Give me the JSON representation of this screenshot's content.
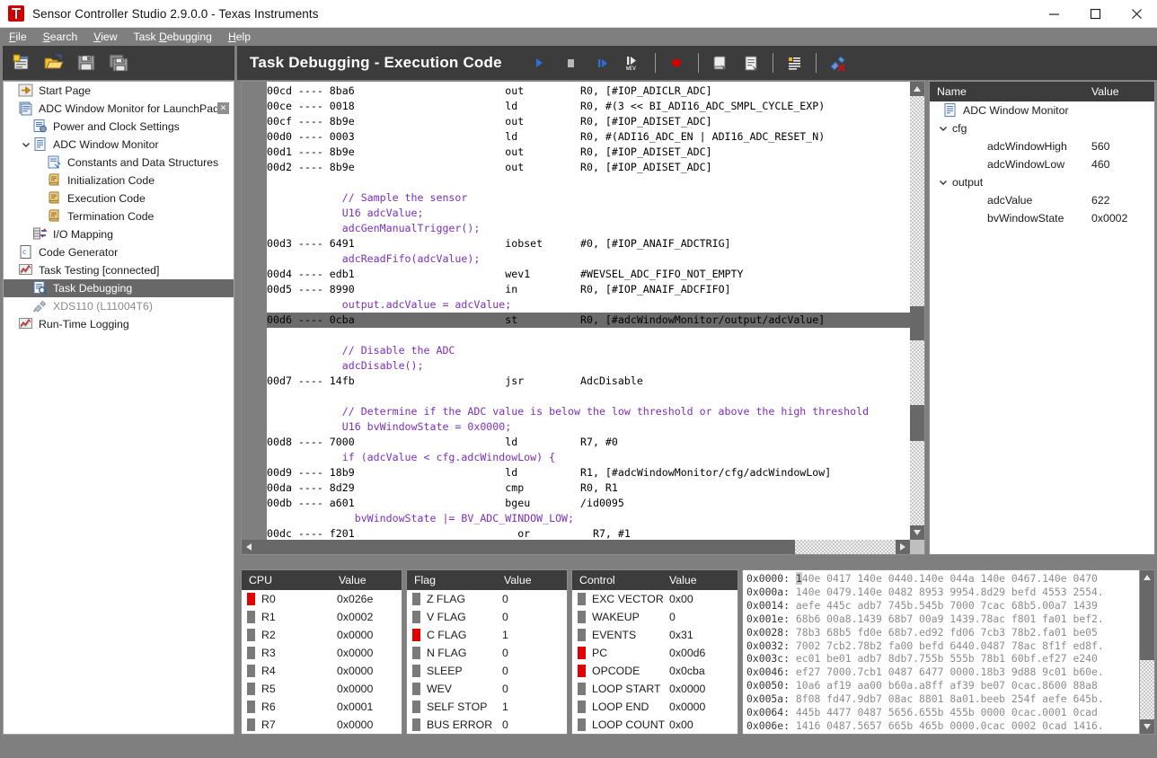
{
  "window": {
    "title": "Sensor Controller Studio 2.9.0.0 - Texas Instruments",
    "logo": "ti-logo",
    "minimize": "minimize-icon",
    "maximize": "maximize-icon",
    "close": "close-icon"
  },
  "menu": [
    {
      "label": "File",
      "mnemonic": "F"
    },
    {
      "label": "Search",
      "mnemonic": "S"
    },
    {
      "label": "View",
      "mnemonic": "V"
    },
    {
      "label": "Task Debugging",
      "mnemonic": "D"
    },
    {
      "label": "Help",
      "mnemonic": "H"
    }
  ],
  "file_toolbar": [
    {
      "name": "new-project-icon"
    },
    {
      "name": "open-project-icon"
    },
    {
      "name": "save-icon"
    },
    {
      "name": "save-all-icon"
    }
  ],
  "header": {
    "title": "Task Debugging - Execution Code",
    "tools": [
      {
        "name": "run-button",
        "kind": "play"
      },
      {
        "name": "stop-button",
        "kind": "stop"
      },
      {
        "name": "step-button",
        "kind": "step"
      },
      {
        "name": "run-to-wev-button",
        "kind": "wev"
      },
      {
        "name": "separator-1",
        "kind": "sep"
      },
      {
        "name": "breakpoint-button",
        "kind": "record"
      },
      {
        "name": "separator-2",
        "kind": "sep"
      },
      {
        "name": "show-source-button",
        "kind": "scroll"
      },
      {
        "name": "show-listing-button",
        "kind": "doc"
      },
      {
        "name": "separator-3",
        "kind": "sep"
      },
      {
        "name": "output-view-button",
        "kind": "list"
      },
      {
        "name": "separator-4",
        "kind": "sep"
      },
      {
        "name": "disconnect-button",
        "kind": "unplug"
      }
    ]
  },
  "sidebar": {
    "items": [
      {
        "label": "Start Page",
        "icon": "arrow-right-icon",
        "indent": 0,
        "chevron": "",
        "selected": false,
        "dim": false,
        "close": false
      },
      {
        "label": "ADC Window Monitor for LaunchPad*",
        "icon": "project-icon",
        "indent": 0,
        "chevron": "",
        "selected": false,
        "dim": false,
        "close": true
      },
      {
        "label": "Power and Clock Settings",
        "icon": "settings-doc-icon",
        "indent": 1,
        "chevron": "",
        "selected": false,
        "dim": false,
        "close": false
      },
      {
        "label": "ADC Window Monitor",
        "icon": "task-icon",
        "indent": 1,
        "chevron": "v",
        "selected": false,
        "dim": false,
        "close": false
      },
      {
        "label": "Constants and Data Structures",
        "icon": "constants-icon",
        "indent": 2,
        "chevron": "",
        "selected": false,
        "dim": false,
        "close": false
      },
      {
        "label": "Initialization Code",
        "icon": "code-scroll-icon",
        "indent": 2,
        "chevron": "",
        "selected": false,
        "dim": false,
        "close": false
      },
      {
        "label": "Execution Code",
        "icon": "code-scroll-icon",
        "indent": 2,
        "chevron": "",
        "selected": false,
        "dim": false,
        "close": false
      },
      {
        "label": "Termination Code",
        "icon": "code-scroll-icon",
        "indent": 2,
        "chevron": "",
        "selected": false,
        "dim": false,
        "close": false
      },
      {
        "label": "I/O Mapping",
        "icon": "io-mapping-icon",
        "indent": 1,
        "chevron": "",
        "selected": false,
        "dim": false,
        "close": false
      },
      {
        "label": "Code Generator",
        "icon": "code-generator-icon",
        "indent": 0,
        "chevron": "",
        "selected": false,
        "dim": false,
        "close": false
      },
      {
        "label": "Task Testing [connected]",
        "icon": "task-testing-icon",
        "indent": 0,
        "chevron": "",
        "selected": false,
        "dim": false,
        "close": false
      },
      {
        "label": "Task Debugging",
        "icon": "task-debugging-icon",
        "indent": 1,
        "chevron": "",
        "selected": true,
        "dim": false,
        "close": false
      },
      {
        "label": "XDS110 (L11004T6)",
        "icon": "probe-icon",
        "indent": 1,
        "chevron": "",
        "selected": false,
        "dim": true,
        "close": false
      },
      {
        "label": "Run-Time Logging",
        "icon": "logging-icon",
        "indent": 0,
        "chevron": "",
        "selected": false,
        "dim": false,
        "close": false
      }
    ]
  },
  "editor": {
    "lines": [
      {
        "addr": "00cd ---- 8ba6",
        "mn": "out",
        "arg": "R0, [#IOP_ADICLR_ADC]",
        "comment": "",
        "indent": 0,
        "hl": false,
        "marker": false
      },
      {
        "addr": "00ce ---- 0018",
        "mn": "ld",
        "arg": "R0, #(3 << BI_ADI16_ADC_SMPL_CYCLE_EXP)",
        "comment": "",
        "indent": 0,
        "hl": false,
        "marker": false
      },
      {
        "addr": "00cf ---- 8b9e",
        "mn": "out",
        "arg": "R0, [#IOP_ADISET_ADC]",
        "comment": "",
        "indent": 0,
        "hl": false,
        "marker": false
      },
      {
        "addr": "00d0 ---- 0003",
        "mn": "ld",
        "arg": "R0, #(ADI16_ADC_EN | ADI16_ADC_RESET_N)",
        "comment": "",
        "indent": 0,
        "hl": false,
        "marker": false
      },
      {
        "addr": "00d1 ---- 8b9e",
        "mn": "out",
        "arg": "R0, [#IOP_ADISET_ADC]",
        "comment": "",
        "indent": 0,
        "hl": false,
        "marker": false
      },
      {
        "addr": "00d2 ---- 8b9e",
        "mn": "out",
        "arg": "R0, [#IOP_ADISET_ADC]",
        "comment": "",
        "indent": 0,
        "hl": false,
        "marker": false
      },
      {
        "addr": "",
        "mn": "",
        "arg": "",
        "comment": "",
        "indent": 0,
        "hl": false,
        "marker": false
      },
      {
        "addr": "",
        "mn": "",
        "arg": "",
        "comment": "// Sample the sensor",
        "indent": 2,
        "hl": false,
        "marker": false
      },
      {
        "addr": "",
        "mn": "",
        "arg": "",
        "comment": "U16 adcValue;",
        "indent": 2,
        "hl": false,
        "marker": false
      },
      {
        "addr": "",
        "mn": "",
        "arg": "",
        "comment": "adcGenManualTrigger();",
        "indent": 2,
        "hl": false,
        "marker": false
      },
      {
        "addr": "00d3 ---- 6491",
        "mn": "iobset",
        "arg": "#0, [#IOP_ANAIF_ADCTRIG]",
        "comment": "",
        "indent": 0,
        "hl": false,
        "marker": false
      },
      {
        "addr": "",
        "mn": "",
        "arg": "",
        "comment": "adcReadFifo(adcValue);",
        "indent": 2,
        "hl": false,
        "marker": false
      },
      {
        "addr": "00d4 ---- edb1",
        "mn": "wev1",
        "arg": "#WEVSEL_ADC_FIFO_NOT_EMPTY",
        "comment": "",
        "indent": 0,
        "hl": false,
        "marker": false
      },
      {
        "addr": "00d5 ---- 8990",
        "mn": "in",
        "arg": "R0, [#IOP_ANAIF_ADCFIFO]",
        "comment": "",
        "indent": 0,
        "hl": false,
        "marker": false
      },
      {
        "addr": "",
        "mn": "",
        "arg": "",
        "comment": "output.adcValue = adcValue;",
        "indent": 2,
        "hl": false,
        "marker": false
      },
      {
        "addr": "00d6 ---- 0cba",
        "mn": "st",
        "arg": "R0, [#adcWindowMonitor/output/adcValue]",
        "comment": "",
        "indent": 0,
        "hl": true,
        "marker": true
      },
      {
        "addr": "",
        "mn": "",
        "arg": "",
        "comment": "",
        "indent": 0,
        "hl": false,
        "marker": false
      },
      {
        "addr": "",
        "mn": "",
        "arg": "",
        "comment": "// Disable the ADC",
        "indent": 2,
        "hl": false,
        "marker": false
      },
      {
        "addr": "",
        "mn": "",
        "arg": "",
        "comment": "adcDisable();",
        "indent": 2,
        "hl": false,
        "marker": false
      },
      {
        "addr": "00d7 ---- 14fb",
        "mn": "jsr",
        "arg": "AdcDisable",
        "comment": "",
        "indent": 0,
        "hl": false,
        "marker": false
      },
      {
        "addr": "",
        "mn": "",
        "arg": "",
        "comment": "",
        "indent": 0,
        "hl": false,
        "marker": false
      },
      {
        "addr": "",
        "mn": "",
        "arg": "",
        "comment": "// Determine if the ADC value is below the low threshold or above the high threshold",
        "indent": 2,
        "hl": false,
        "marker": false
      },
      {
        "addr": "",
        "mn": "",
        "arg": "",
        "comment": "U16 bvWindowState = 0x0000;",
        "indent": 2,
        "hl": false,
        "marker": false
      },
      {
        "addr": "00d8 ---- 7000",
        "mn": "ld",
        "arg": "R7, #0",
        "comment": "",
        "indent": 0,
        "hl": false,
        "marker": false
      },
      {
        "addr": "",
        "mn": "",
        "arg": "",
        "comment": "if (adcValue < cfg.adcWindowLow) {",
        "indent": 2,
        "hl": false,
        "marker": false
      },
      {
        "addr": "00d9 ---- 18b9",
        "mn": "ld",
        "arg": "R1, [#adcWindowMonitor/cfg/adcWindowLow]",
        "comment": "",
        "indent": 0,
        "hl": false,
        "marker": false
      },
      {
        "addr": "00da ---- 8d29",
        "mn": "cmp",
        "arg": "R0, R1",
        "comment": "",
        "indent": 0,
        "hl": false,
        "marker": false
      },
      {
        "addr": "00db ---- a601",
        "mn": "bgeu",
        "arg": "/id0095",
        "comment": "",
        "indent": 0,
        "hl": false,
        "marker": false
      },
      {
        "addr": "",
        "mn": "",
        "arg": "",
        "comment": "bvWindowState |= BV_ADC_WINDOW_LOW;",
        "indent": 3,
        "hl": false,
        "marker": false
      },
      {
        "addr": "00dc ---- f201",
        "mn": "or",
        "arg": "R7, #1",
        "comment": "",
        "indent": 1,
        "hl": false,
        "marker": false
      },
      {
        "addr": "",
        "mn": "",
        "arg": "",
        "comment": "}",
        "indent": 3,
        "hl": false,
        "marker": false
      }
    ]
  },
  "variables": {
    "header": {
      "name": "Name",
      "value": "Value"
    },
    "rows": [
      {
        "label": "ADC Window Monitor",
        "value": "",
        "indent": 0,
        "icon": "task-icon",
        "chevron": ""
      },
      {
        "label": "cfg",
        "value": "",
        "indent": 0,
        "icon": "",
        "chevron": "v"
      },
      {
        "label": "adcWindowHigh",
        "value": "560",
        "indent": 2,
        "icon": "",
        "chevron": ""
      },
      {
        "label": "adcWindowLow",
        "value": "460",
        "indent": 2,
        "icon": "",
        "chevron": ""
      },
      {
        "label": "output",
        "value": "",
        "indent": 0,
        "icon": "",
        "chevron": "v"
      },
      {
        "label": "adcValue",
        "value": "622",
        "indent": 2,
        "icon": "",
        "chevron": ""
      },
      {
        "label": "bvWindowState",
        "value": "0x0002",
        "indent": 2,
        "icon": "",
        "chevron": ""
      }
    ]
  },
  "cpu_panel": {
    "header": {
      "name": "CPU",
      "value": "Value"
    },
    "rows": [
      {
        "label": "R0",
        "value": "0x026e",
        "changed": true
      },
      {
        "label": "R1",
        "value": "0x0002",
        "changed": false
      },
      {
        "label": "R2",
        "value": "0x0000",
        "changed": false
      },
      {
        "label": "R3",
        "value": "0x0000",
        "changed": false
      },
      {
        "label": "R4",
        "value": "0x0000",
        "changed": false
      },
      {
        "label": "R5",
        "value": "0x0000",
        "changed": false
      },
      {
        "label": "R6",
        "value": "0x0001",
        "changed": false
      },
      {
        "label": "R7",
        "value": "0x0000",
        "changed": false
      }
    ]
  },
  "flag_panel": {
    "header": {
      "name": "Flag",
      "value": "Value"
    },
    "rows": [
      {
        "label": "Z FLAG",
        "value": "0",
        "changed": false
      },
      {
        "label": "V FLAG",
        "value": "0",
        "changed": false
      },
      {
        "label": "C FLAG",
        "value": "1",
        "changed": true
      },
      {
        "label": "N FLAG",
        "value": "0",
        "changed": false
      },
      {
        "label": "SLEEP",
        "value": "0",
        "changed": false
      },
      {
        "label": "WEV",
        "value": "0",
        "changed": false
      },
      {
        "label": "SELF STOP",
        "value": "1",
        "changed": false
      },
      {
        "label": "BUS ERROR",
        "value": "0",
        "changed": false
      }
    ]
  },
  "control_panel": {
    "header": {
      "name": "Control",
      "value": "Value"
    },
    "rows": [
      {
        "label": "EXC VECTOR",
        "value": "0x00",
        "changed": false
      },
      {
        "label": "WAKEUP",
        "value": "0",
        "changed": false
      },
      {
        "label": "EVENTS",
        "value": "0x31",
        "changed": false
      },
      {
        "label": "PC",
        "value": "0x00d6",
        "changed": true
      },
      {
        "label": "OPCODE",
        "value": "0x0cba",
        "changed": true
      },
      {
        "label": "LOOP START",
        "value": "0x0000",
        "changed": false
      },
      {
        "label": "LOOP END",
        "value": "0x0000",
        "changed": false
      },
      {
        "label": "LOOP COUNT",
        "value": "0x00",
        "changed": false
      }
    ]
  },
  "memory_panel": {
    "rows": [
      {
        "addr": "0x0000:",
        "data": "140e 0417 140e 0440.140e 044a 140e 0467.140e 0470"
      },
      {
        "addr": "0x000a:",
        "data": "140e 0479.140e 0482 8953 9954.8d29 befd 4553 2554."
      },
      {
        "addr": "0x0014:",
        "data": "aefe 445c adb7 745b.545b 7000 7cac 68b5.00a7 1439"
      },
      {
        "addr": "0x001e:",
        "data": "68b6 00a8.1439 68b7 00a9 1439.78ac f801 fa01 bef2."
      },
      {
        "addr": "0x0028:",
        "data": "78b3 68b5 fd0e 68b7.ed92 fd06 7cb3 78b2.fa01 be05"
      },
      {
        "addr": "0x0032:",
        "data": "7002 7cb2.78b2 fa00 befd 6440.0487 78ac 8f1f ed8f."
      },
      {
        "addr": "0x003c:",
        "data": "ec01 be01 adb7 8db7.755b 555b 78b1 60bf.ef27 e240"
      },
      {
        "addr": "0x0046:",
        "data": "ef27 7000.7cb1 0487 6477 0000.18b3 9d88 9c01 b60e."
      },
      {
        "addr": "0x0050:",
        "data": "10a6 af19 aa00 b60a.a8ff af39 be07 0cac.8600 88a8"
      },
      {
        "addr": "0x005a:",
        "data": "8f08 fd47.9db7 08ac 8801 8a01.beeb 254f aefe 645b."
      },
      {
        "addr": "0x0064:",
        "data": "445b 4477 0487 5656.655b 455b 0000 0cac.0001 0cad"
      },
      {
        "addr": "0x006e:",
        "data": "1416 0487.5657 665b 465b 0000.0cac 0002 0cad 1416."
      }
    ]
  },
  "colors": {
    "accent_red": "#e00000",
    "comment_purple": "#7b2fbe",
    "panel_dark": "#3c3c3c",
    "chrome_gray": "#807f7f",
    "selection_gray": "#686868"
  }
}
